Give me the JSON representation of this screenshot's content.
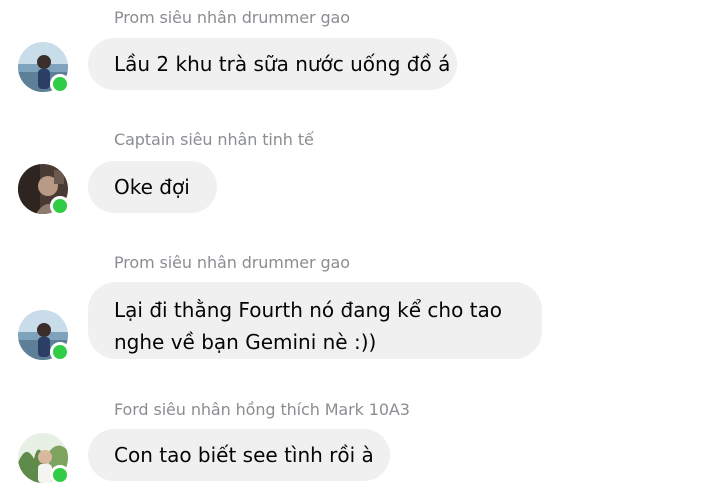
{
  "messages": [
    {
      "sender": "Prom siêu nhân drummer gao",
      "text": "Lầu 2 khu trà sữa nước uống đồ á",
      "avatar_icon": "profile-photo-boy-by-sea"
    },
    {
      "sender": "Captain siêu nhân tinh tế",
      "text": "Oke đợi",
      "avatar_icon": "profile-photo-dark-portrait"
    },
    {
      "sender": "Prom siêu nhân drummer gao",
      "text_lines": [
        "Lại đi thằng Fourth nó đang kể cho tao",
        "nghe về bạn Gemini nè :))"
      ],
      "avatar_icon": "profile-photo-boy-by-sea"
    },
    {
      "sender": "Ford siêu nhân hồng thích Mark 10A3",
      "text": "Con tao biết see tình rồi à",
      "avatar_icon": "profile-photo-boy-with-plants"
    }
  ],
  "colors": {
    "bubble_bg": "#f0f0f0",
    "sender_text": "#8a8d91",
    "message_text": "#050505",
    "online_indicator": "#31cc46"
  }
}
